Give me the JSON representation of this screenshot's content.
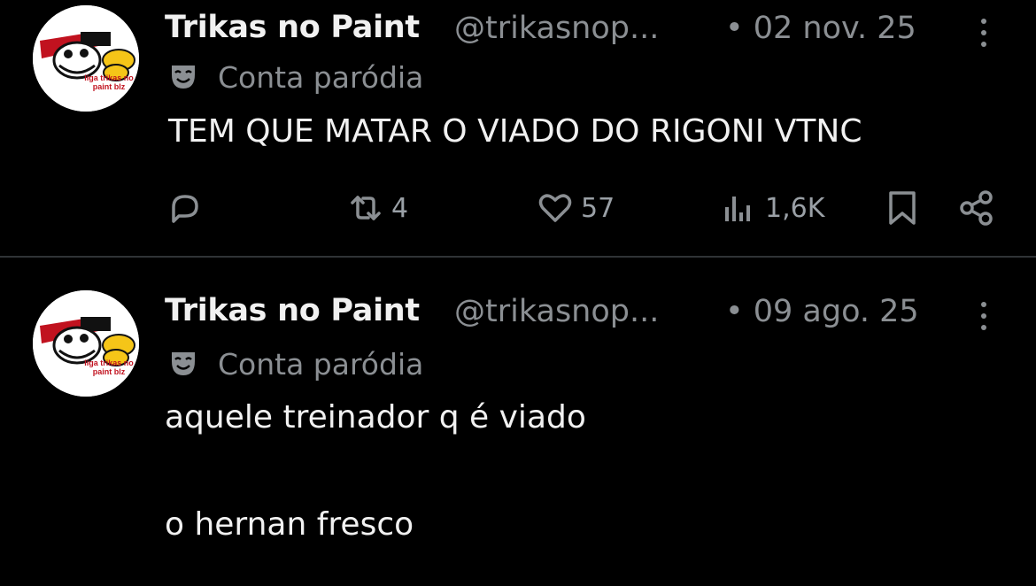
{
  "posts": [
    {
      "display_name": "Trikas no Paint",
      "handle": "@trikasnop...",
      "date": "• 02 nov. 25",
      "badge_label": "Conta paródia",
      "avatar_text": "liga trikas no paint blz",
      "text": "TEM QUE MATAR O VIADO DO RIGONI VTNC",
      "stats": {
        "reposts": "4",
        "likes": "57",
        "views": "1,6K"
      }
    },
    {
      "display_name": "Trikas no Paint",
      "handle": "@trikasnop...",
      "date": "• 09 ago. 25",
      "badge_label": "Conta paródia",
      "avatar_text": "liga trikas no paint blz",
      "text_lines": [
        "aquele treinador q é viado",
        "o hernan fresco"
      ]
    }
  ],
  "icons": {
    "reply": "reply-icon",
    "repost": "repost-icon",
    "like": "heart-icon",
    "views": "views-icon",
    "bookmark": "bookmark-icon",
    "share": "share-icon",
    "more": "more-icon",
    "badge": "parody-mask-icon"
  },
  "colors": {
    "background": "#000000",
    "text": "#e7e9ea",
    "muted": "#8b8f93",
    "divider": "#2f3336"
  }
}
